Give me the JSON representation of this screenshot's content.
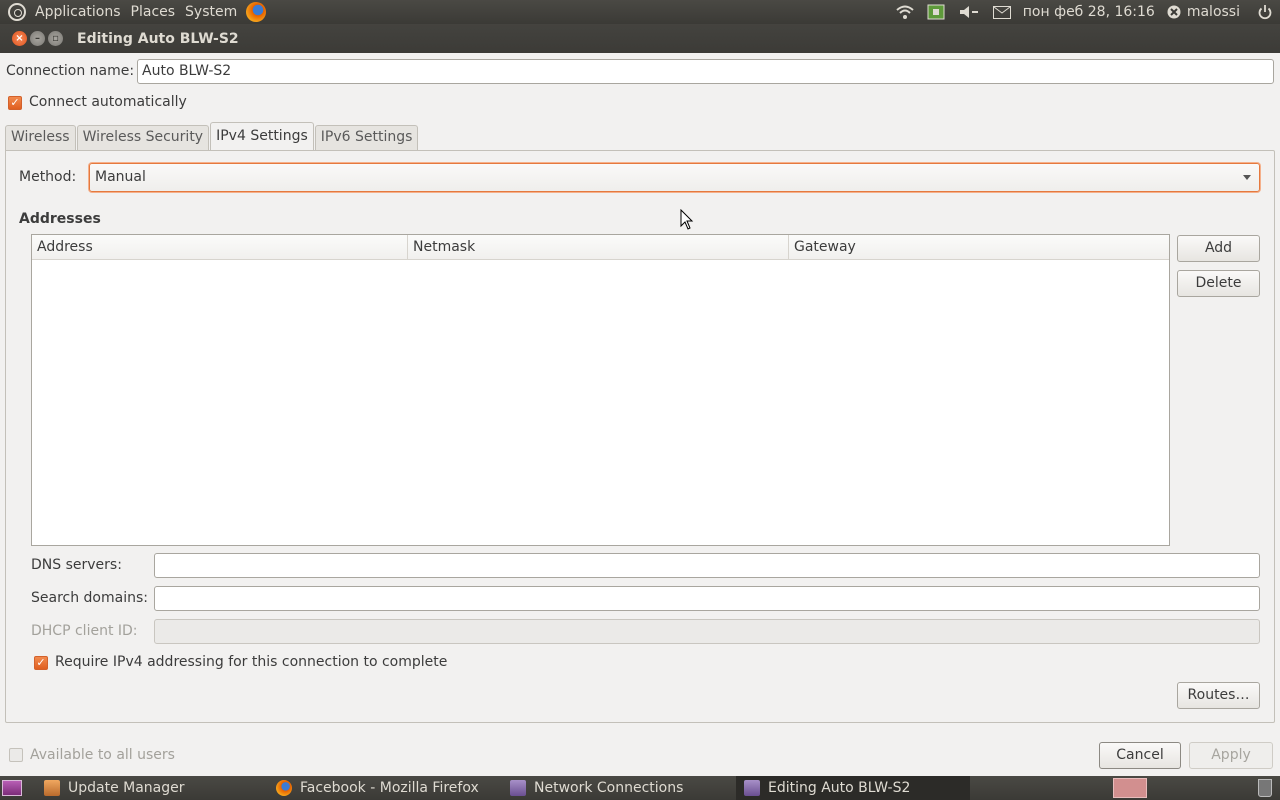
{
  "top_panel": {
    "menus": [
      "Applications",
      "Places",
      "System"
    ],
    "clock": "пон феб 28, 16:16",
    "user": "malossi",
    "icons": [
      "wifi-icon",
      "network-manager-icon",
      "volume-icon",
      "mail-icon",
      "user-status-icon",
      "power-icon"
    ]
  },
  "window": {
    "title": "Editing Auto BLW-S2"
  },
  "dialog": {
    "connection_name_label": "Connection name:",
    "connection_name_value": "Auto BLW-S2",
    "connect_automatically_label": "Connect automatically",
    "connect_automatically_checked": true,
    "tabs": [
      {
        "label": "Wireless",
        "active": false
      },
      {
        "label": "Wireless Security",
        "active": false
      },
      {
        "label": "IPv4 Settings",
        "active": true
      },
      {
        "label": "IPv6 Settings",
        "active": false
      }
    ],
    "method_label": "Method:",
    "method_value": "Manual",
    "addresses_heading": "Addresses",
    "addresses_columns": [
      "Address",
      "Netmask",
      "Gateway"
    ],
    "addresses_rows": [],
    "add_button": "Add",
    "delete_button": "Delete",
    "dns_label": "DNS servers:",
    "dns_value": "",
    "search_domains_label": "Search domains:",
    "search_domains_value": "",
    "dhcp_client_id_label": "DHCP client ID:",
    "dhcp_client_id_value": "",
    "require_ipv4_label": "Require IPv4 addressing for this connection to complete",
    "require_ipv4_checked": true,
    "routes_button": "Routes…",
    "available_all_users_label": "Available to all users",
    "available_all_users_checked": false,
    "cancel_button": "Cancel",
    "apply_button": "Apply"
  },
  "taskbar": {
    "tasks": [
      {
        "label": "Update Manager",
        "icon": "update-manager-icon",
        "active": false
      },
      {
        "label": "Facebook - Mozilla Firefox",
        "icon": "firefox-icon",
        "active": false
      },
      {
        "label": "Network Connections",
        "icon": "network-connections-icon",
        "active": false
      },
      {
        "label": "Editing Auto BLW-S2",
        "icon": "network-connections-icon",
        "active": true
      }
    ]
  },
  "colors": {
    "accent": "#e05f20",
    "panel_bg": "#3c3b37",
    "window_bg": "#f2f1f0"
  }
}
